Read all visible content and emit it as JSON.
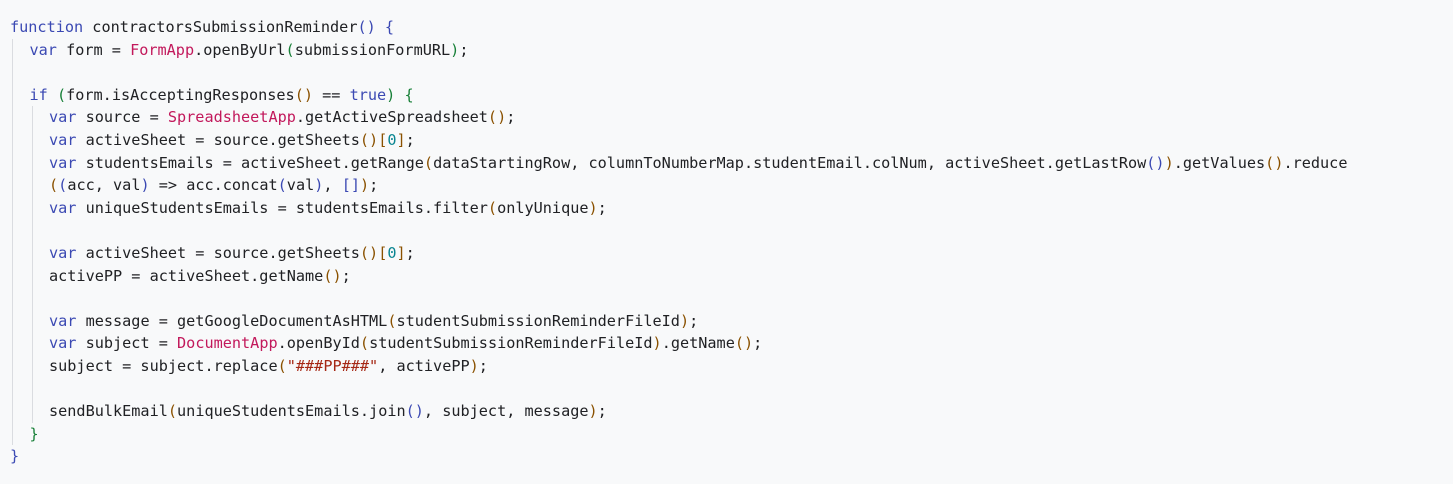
{
  "colors": {
    "background": "#f8f9fa",
    "keyword": "#3b49b3",
    "class": "#c2185b",
    "string": "#a52714",
    "number": "#098591",
    "text": "#202124",
    "bracket_level_2": "#188038",
    "bracket_level_3": "#8a5100",
    "indent_guide": "#dadce0"
  },
  "lines": [
    {
      "indent": 0,
      "tokens": [
        [
          "kw",
          "function"
        ],
        [
          "t",
          " contractorsSubmissionReminder"
        ],
        [
          "p1",
          "()"
        ],
        [
          "t",
          " "
        ],
        [
          "p1",
          "{"
        ]
      ]
    },
    {
      "indent": 1,
      "tokens": [
        [
          "kw",
          "var"
        ],
        [
          "t",
          " form = "
        ],
        [
          "cls",
          "FormApp"
        ],
        [
          "t",
          ".openByUrl"
        ],
        [
          "p2",
          "("
        ],
        [
          "t",
          "submissionFormURL"
        ],
        [
          "p2",
          ")"
        ],
        [
          "t",
          ";"
        ]
      ]
    },
    {
      "indent": 1,
      "tokens": []
    },
    {
      "indent": 1,
      "tokens": [
        [
          "kw",
          "if"
        ],
        [
          "t",
          " "
        ],
        [
          "p2",
          "("
        ],
        [
          "t",
          "form.isAcceptingResponses"
        ],
        [
          "p3",
          "()"
        ],
        [
          "t",
          " == "
        ],
        [
          "lit",
          "true"
        ],
        [
          "p2",
          ")"
        ],
        [
          "t",
          " "
        ],
        [
          "p2",
          "{"
        ]
      ]
    },
    {
      "indent": 2,
      "tokens": [
        [
          "kw",
          "var"
        ],
        [
          "t",
          " source = "
        ],
        [
          "cls",
          "SpreadsheetApp"
        ],
        [
          "t",
          ".getActiveSpreadsheet"
        ],
        [
          "p3",
          "()"
        ],
        [
          "t",
          ";"
        ]
      ]
    },
    {
      "indent": 2,
      "tokens": [
        [
          "kw",
          "var"
        ],
        [
          "t",
          " activeSheet = source.getSheets"
        ],
        [
          "p3",
          "()"
        ],
        [
          "p3",
          "["
        ],
        [
          "num",
          "0"
        ],
        [
          "p3",
          "]"
        ],
        [
          "t",
          ";"
        ]
      ]
    },
    {
      "indent": 2,
      "tokens": [
        [
          "kw",
          "var"
        ],
        [
          "t",
          " studentsEmails = activeSheet.getRange"
        ],
        [
          "p3",
          "("
        ],
        [
          "t",
          "dataStartingRow, columnToNumberMap.studentEmail.colNum, activeSheet.getLastRow"
        ],
        [
          "p1",
          "()"
        ],
        [
          "p3",
          ")"
        ],
        [
          "t",
          ".getValues"
        ],
        [
          "p3",
          "()"
        ],
        [
          "t",
          ".reduce"
        ]
      ]
    },
    {
      "indent": 2,
      "tokens": [
        [
          "p3",
          "("
        ],
        [
          "p1",
          "("
        ],
        [
          "t",
          "acc, val"
        ],
        [
          "p1",
          ")"
        ],
        [
          "t",
          " => acc.concat"
        ],
        [
          "p1",
          "("
        ],
        [
          "t",
          "val"
        ],
        [
          "p1",
          ")"
        ],
        [
          "t",
          ", "
        ],
        [
          "p1",
          "[]"
        ],
        [
          "p3",
          ")"
        ],
        [
          "t",
          ";"
        ]
      ]
    },
    {
      "indent": 2,
      "tokens": [
        [
          "kw",
          "var"
        ],
        [
          "t",
          " uniqueStudentsEmails = studentsEmails.filter"
        ],
        [
          "p3",
          "("
        ],
        [
          "t",
          "onlyUnique"
        ],
        [
          "p3",
          ")"
        ],
        [
          "t",
          ";"
        ]
      ]
    },
    {
      "indent": 2,
      "tokens": []
    },
    {
      "indent": 2,
      "tokens": [
        [
          "kw",
          "var"
        ],
        [
          "t",
          " activeSheet = source.getSheets"
        ],
        [
          "p3",
          "()"
        ],
        [
          "p3",
          "["
        ],
        [
          "num",
          "0"
        ],
        [
          "p3",
          "]"
        ],
        [
          "t",
          ";"
        ]
      ]
    },
    {
      "indent": 2,
      "tokens": [
        [
          "t",
          "activePP = activeSheet.getName"
        ],
        [
          "p3",
          "()"
        ],
        [
          "t",
          ";"
        ]
      ]
    },
    {
      "indent": 2,
      "tokens": []
    },
    {
      "indent": 2,
      "tokens": [
        [
          "kw",
          "var"
        ],
        [
          "t",
          " message = getGoogleDocumentAsHTML"
        ],
        [
          "p3",
          "("
        ],
        [
          "t",
          "studentSubmissionReminderFileId"
        ],
        [
          "p3",
          ")"
        ],
        [
          "t",
          ";"
        ]
      ]
    },
    {
      "indent": 2,
      "tokens": [
        [
          "kw",
          "var"
        ],
        [
          "t",
          " subject = "
        ],
        [
          "cls",
          "DocumentApp"
        ],
        [
          "t",
          ".openById"
        ],
        [
          "p3",
          "("
        ],
        [
          "t",
          "studentSubmissionReminderFileId"
        ],
        [
          "p3",
          ")"
        ],
        [
          "t",
          ".getName"
        ],
        [
          "p3",
          "()"
        ],
        [
          "t",
          ";"
        ]
      ]
    },
    {
      "indent": 2,
      "tokens": [
        [
          "t",
          "subject = subject.replace"
        ],
        [
          "p3",
          "("
        ],
        [
          "str",
          "\"###PP###\""
        ],
        [
          "t",
          ", activePP"
        ],
        [
          "p3",
          ")"
        ],
        [
          "t",
          ";"
        ]
      ]
    },
    {
      "indent": 2,
      "tokens": []
    },
    {
      "indent": 2,
      "tokens": [
        [
          "t",
          "sendBulkEmail"
        ],
        [
          "p3",
          "("
        ],
        [
          "t",
          "uniqueStudentsEmails.join"
        ],
        [
          "p1",
          "()"
        ],
        [
          "t",
          ", subject, message"
        ],
        [
          "p3",
          ")"
        ],
        [
          "t",
          ";"
        ]
      ]
    },
    {
      "indent": 1,
      "tokens": [
        [
          "p2",
          "}"
        ]
      ]
    },
    {
      "indent": 0,
      "tokens": [
        [
          "p1",
          "}"
        ]
      ]
    }
  ]
}
